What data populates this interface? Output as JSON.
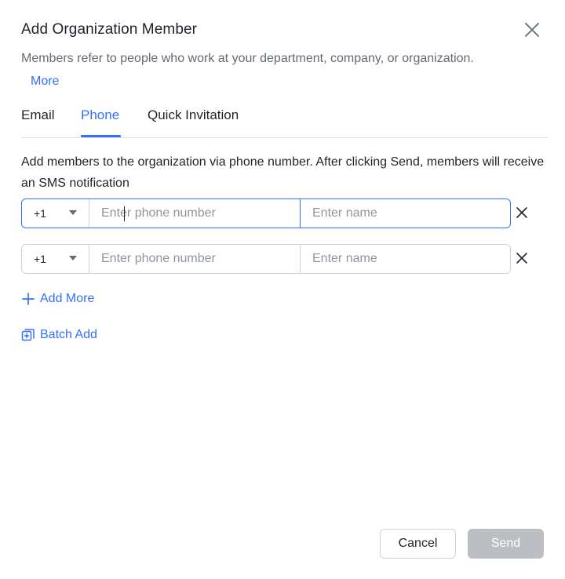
{
  "dialog": {
    "title": "Add Organization Member",
    "description": "Members refer to people who work at your department, company, or organization.",
    "more_link": "More",
    "close_icon": "close-icon"
  },
  "tabs": [
    {
      "label": "Email",
      "active": false
    },
    {
      "label": "Phone",
      "active": true
    },
    {
      "label": "Quick Invitation",
      "active": false
    }
  ],
  "instruction": "Add members to the organization via phone number. After clicking Send, members will receive an SMS notification",
  "rows": [
    {
      "country_code": "+1",
      "phone_placeholder": "Enter phone number",
      "phone_value": "",
      "name_placeholder": "Enter name",
      "name_value": "",
      "focused": true
    },
    {
      "country_code": "+1",
      "phone_placeholder": "Enter phone number",
      "phone_value": "",
      "name_placeholder": "Enter name",
      "name_value": "",
      "focused": false
    }
  ],
  "actions": {
    "add_more": "Add More",
    "batch_add": "Batch Add"
  },
  "footer": {
    "cancel": "Cancel",
    "send": "Send"
  },
  "colors": {
    "accent": "#3370ff",
    "disabled_button": "#bbbfc4",
    "text_primary": "#1f2329",
    "text_secondary": "#646a73"
  }
}
